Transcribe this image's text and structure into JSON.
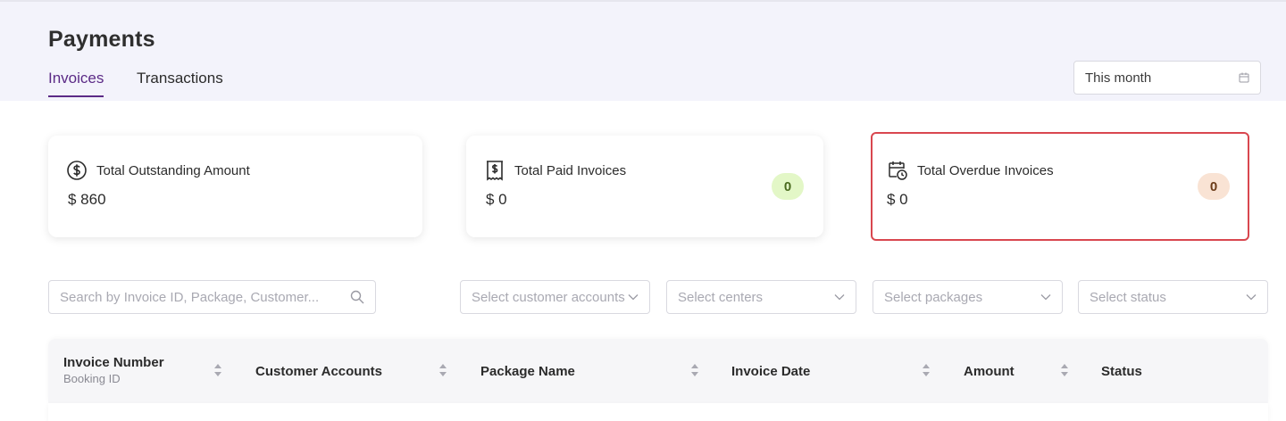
{
  "header": {
    "title": "Payments",
    "tabs": [
      {
        "label": "Invoices",
        "active": true
      },
      {
        "label": "Transactions",
        "active": false
      }
    ],
    "date_filter": {
      "value": "This month",
      "icon": "calendar-icon"
    }
  },
  "summary_cards": [
    {
      "title": "Total Outstanding Amount",
      "value": "$ 860",
      "icon": "dollar-circle-icon"
    },
    {
      "title": "Total Paid Invoices",
      "value": "$ 0",
      "count": "0",
      "icon": "receipt-dollar-icon",
      "badge_color": "#e3f7c7"
    },
    {
      "title": "Total Overdue Invoices",
      "value": "$ 0",
      "count": "0",
      "icon": "calendar-clock-icon",
      "badge_color": "#f9e3d4",
      "highlighted": true,
      "highlight_color": "#d9474f"
    }
  ],
  "filters": {
    "search_placeholder": "Search by Invoice ID, Package, Customer...",
    "customer_accounts_placeholder": "Select customer accounts",
    "centers_placeholder": "Select centers",
    "packages_placeholder": "Select packages",
    "status_placeholder": "Select status"
  },
  "table": {
    "columns": [
      {
        "label": "Invoice Number",
        "sublabel": "Booking ID",
        "sortable": true
      },
      {
        "label": "Customer Accounts",
        "sortable": true
      },
      {
        "label": "Package Name",
        "sortable": true
      },
      {
        "label": "Invoice Date",
        "sortable": true
      },
      {
        "label": "Amount",
        "sortable": true
      },
      {
        "label": "Status",
        "sortable": false
      }
    ]
  },
  "colors": {
    "accent": "#5b2a86",
    "header_bg": "#f3f3fb",
    "table_head_bg": "#f6f6f8"
  }
}
